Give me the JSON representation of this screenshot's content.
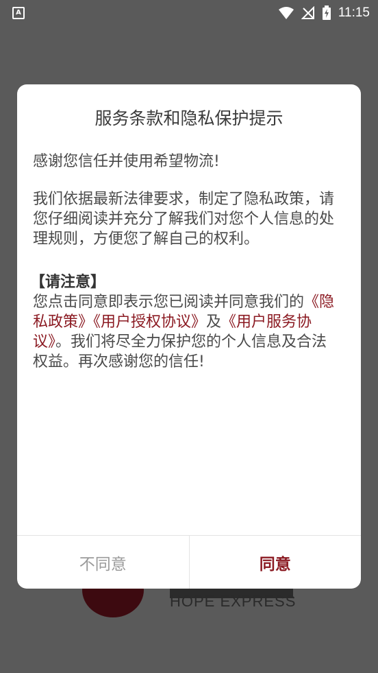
{
  "status_bar": {
    "app_icon_letter": "A",
    "time": "11:15"
  },
  "splash": {
    "brand_text": "HOPE EXPRESS"
  },
  "dialog": {
    "title": "服务条款和隐私保护提示",
    "greeting": "感谢您信任并使用希望物流!",
    "policy_paragraph": "我们依据最新法律要求，制定了隐私政策，请您仔细阅读并充分了解我们对您个人信息的处理规则，方便您了解自己的权利。",
    "notice_heading": "【请注意】",
    "notice_prefix": "您点击同意即表示您已阅读并同意我们的",
    "link_privacy": "《隐私政策》",
    "link_authorization": "《用户授权协议》",
    "connector_and": "及",
    "link_service": "《用户服务协议》",
    "notice_suffix": "。我们将尽全力保护您的个人信息及合法权益。再次感谢您的信任!",
    "disagree_label": "不同意",
    "agree_label": "同意"
  },
  "colors": {
    "accent": "#8b1a22",
    "overlay": "#5a5a5a"
  }
}
